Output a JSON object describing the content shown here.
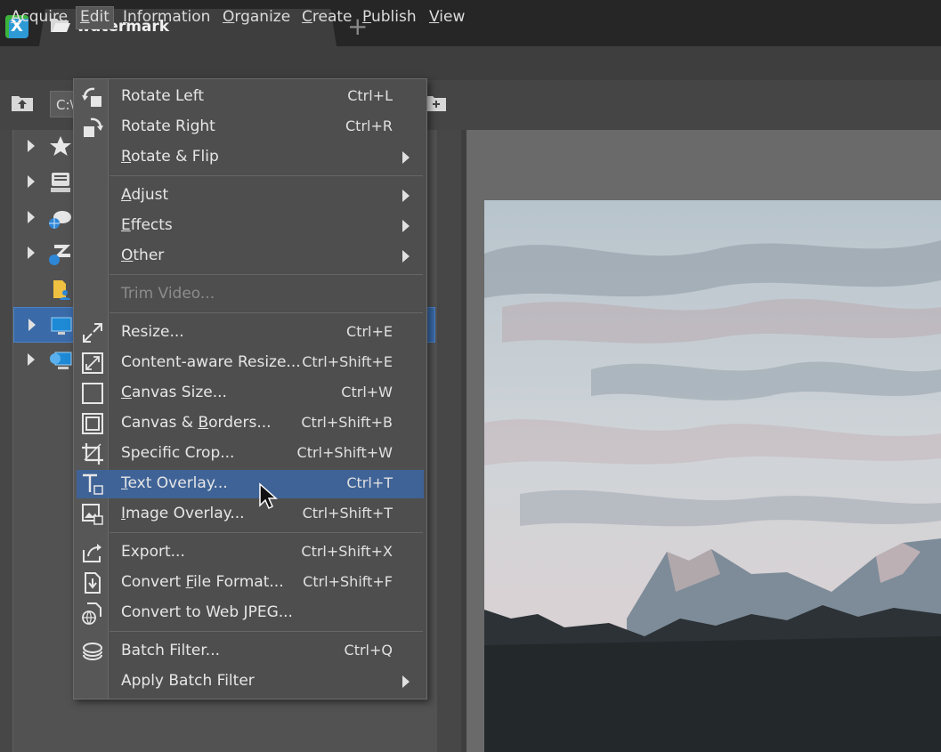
{
  "app": {
    "logo_letter": "X",
    "tab_title": "watermark",
    "new_tab": "+"
  },
  "menubar": [
    {
      "label": "Acquire",
      "u": "A",
      "rest": "cquire"
    },
    {
      "label": "Edit",
      "u": "E",
      "rest": "dit"
    },
    {
      "label": "Information",
      "u": "I",
      "rest": "nformation"
    },
    {
      "label": "Organize",
      "u": "O",
      "rest": "rganize"
    },
    {
      "label": "Create",
      "u": "C",
      "rest": "reate"
    },
    {
      "label": "Publish",
      "u": "P",
      "rest": "ublish"
    },
    {
      "label": "View",
      "u": "V",
      "rest": "iew"
    }
  ],
  "toolbar": {
    "path_value": "C:\\"
  },
  "edit_menu": {
    "items": [
      {
        "pre": "",
        "u": "",
        "post": "Rotate Left",
        "shortcut": "Ctrl+L",
        "icon": "rotate-left-icon"
      },
      {
        "pre": "",
        "u": "",
        "post": "Rotate Right",
        "shortcut": "Ctrl+R",
        "icon": "rotate-right-icon"
      },
      {
        "pre": "",
        "u": "R",
        "post": "otate & Flip",
        "shortcut": "",
        "icon": ""
      },
      {
        "pre": "",
        "u": "A",
        "post": "djust",
        "shortcut": "",
        "icon": ""
      },
      {
        "pre": "",
        "u": "E",
        "post": "ffects",
        "shortcut": "",
        "icon": ""
      },
      {
        "pre": "",
        "u": "O",
        "post": "ther",
        "shortcut": "",
        "icon": ""
      },
      {
        "pre": "",
        "u": "",
        "post": "Trim Video...",
        "shortcut": "",
        "icon": ""
      },
      {
        "pre": "",
        "u": "",
        "post": "Resize...",
        "shortcut": "Ctrl+E",
        "icon": "resize-icon"
      },
      {
        "pre": "",
        "u": "",
        "post": "Content-aware Resize...",
        "shortcut": "Ctrl+Shift+E",
        "icon": "content-aware-resize-icon"
      },
      {
        "pre": "",
        "u": "C",
        "post": "anvas Size...",
        "shortcut": "Ctrl+W",
        "icon": "canvas-size-icon"
      },
      {
        "pre": "Canvas & ",
        "u": "B",
        "post": "orders...",
        "shortcut": "Ctrl+Shift+B",
        "icon": "canvas-borders-icon"
      },
      {
        "pre": "",
        "u": "",
        "post": "Specific Crop...",
        "shortcut": "Ctrl+Shift+W",
        "icon": "crop-icon"
      },
      {
        "pre": "",
        "u": "T",
        "post": "ext Overlay...",
        "shortcut": "Ctrl+T",
        "icon": "text-overlay-icon"
      },
      {
        "pre": "",
        "u": "I",
        "post": "mage Overlay...",
        "shortcut": "Ctrl+Shift+T",
        "icon": "image-overlay-icon"
      },
      {
        "pre": "",
        "u": "",
        "post": "Export...",
        "shortcut": "Ctrl+Shift+X",
        "icon": "export-icon"
      },
      {
        "pre": "Convert ",
        "u": "F",
        "post": "ile Format...",
        "shortcut": "Ctrl+Shift+F",
        "icon": "convert-format-icon"
      },
      {
        "pre": "",
        "u": "",
        "post": "Convert to Web JPEG...",
        "shortcut": "",
        "icon": "web-jpeg-icon"
      },
      {
        "pre": "",
        "u": "",
        "post": "Batch Filter...",
        "shortcut": "Ctrl+Q",
        "icon": "batch-filter-icon"
      },
      {
        "pre": "",
        "u": "",
        "post": "Apply Batch Filter",
        "shortcut": "",
        "icon": ""
      }
    ]
  },
  "colors": {
    "highlight": "#3f6397",
    "selected_tree": "#3b6aa8",
    "accent_logo": "#2d9ad6"
  }
}
